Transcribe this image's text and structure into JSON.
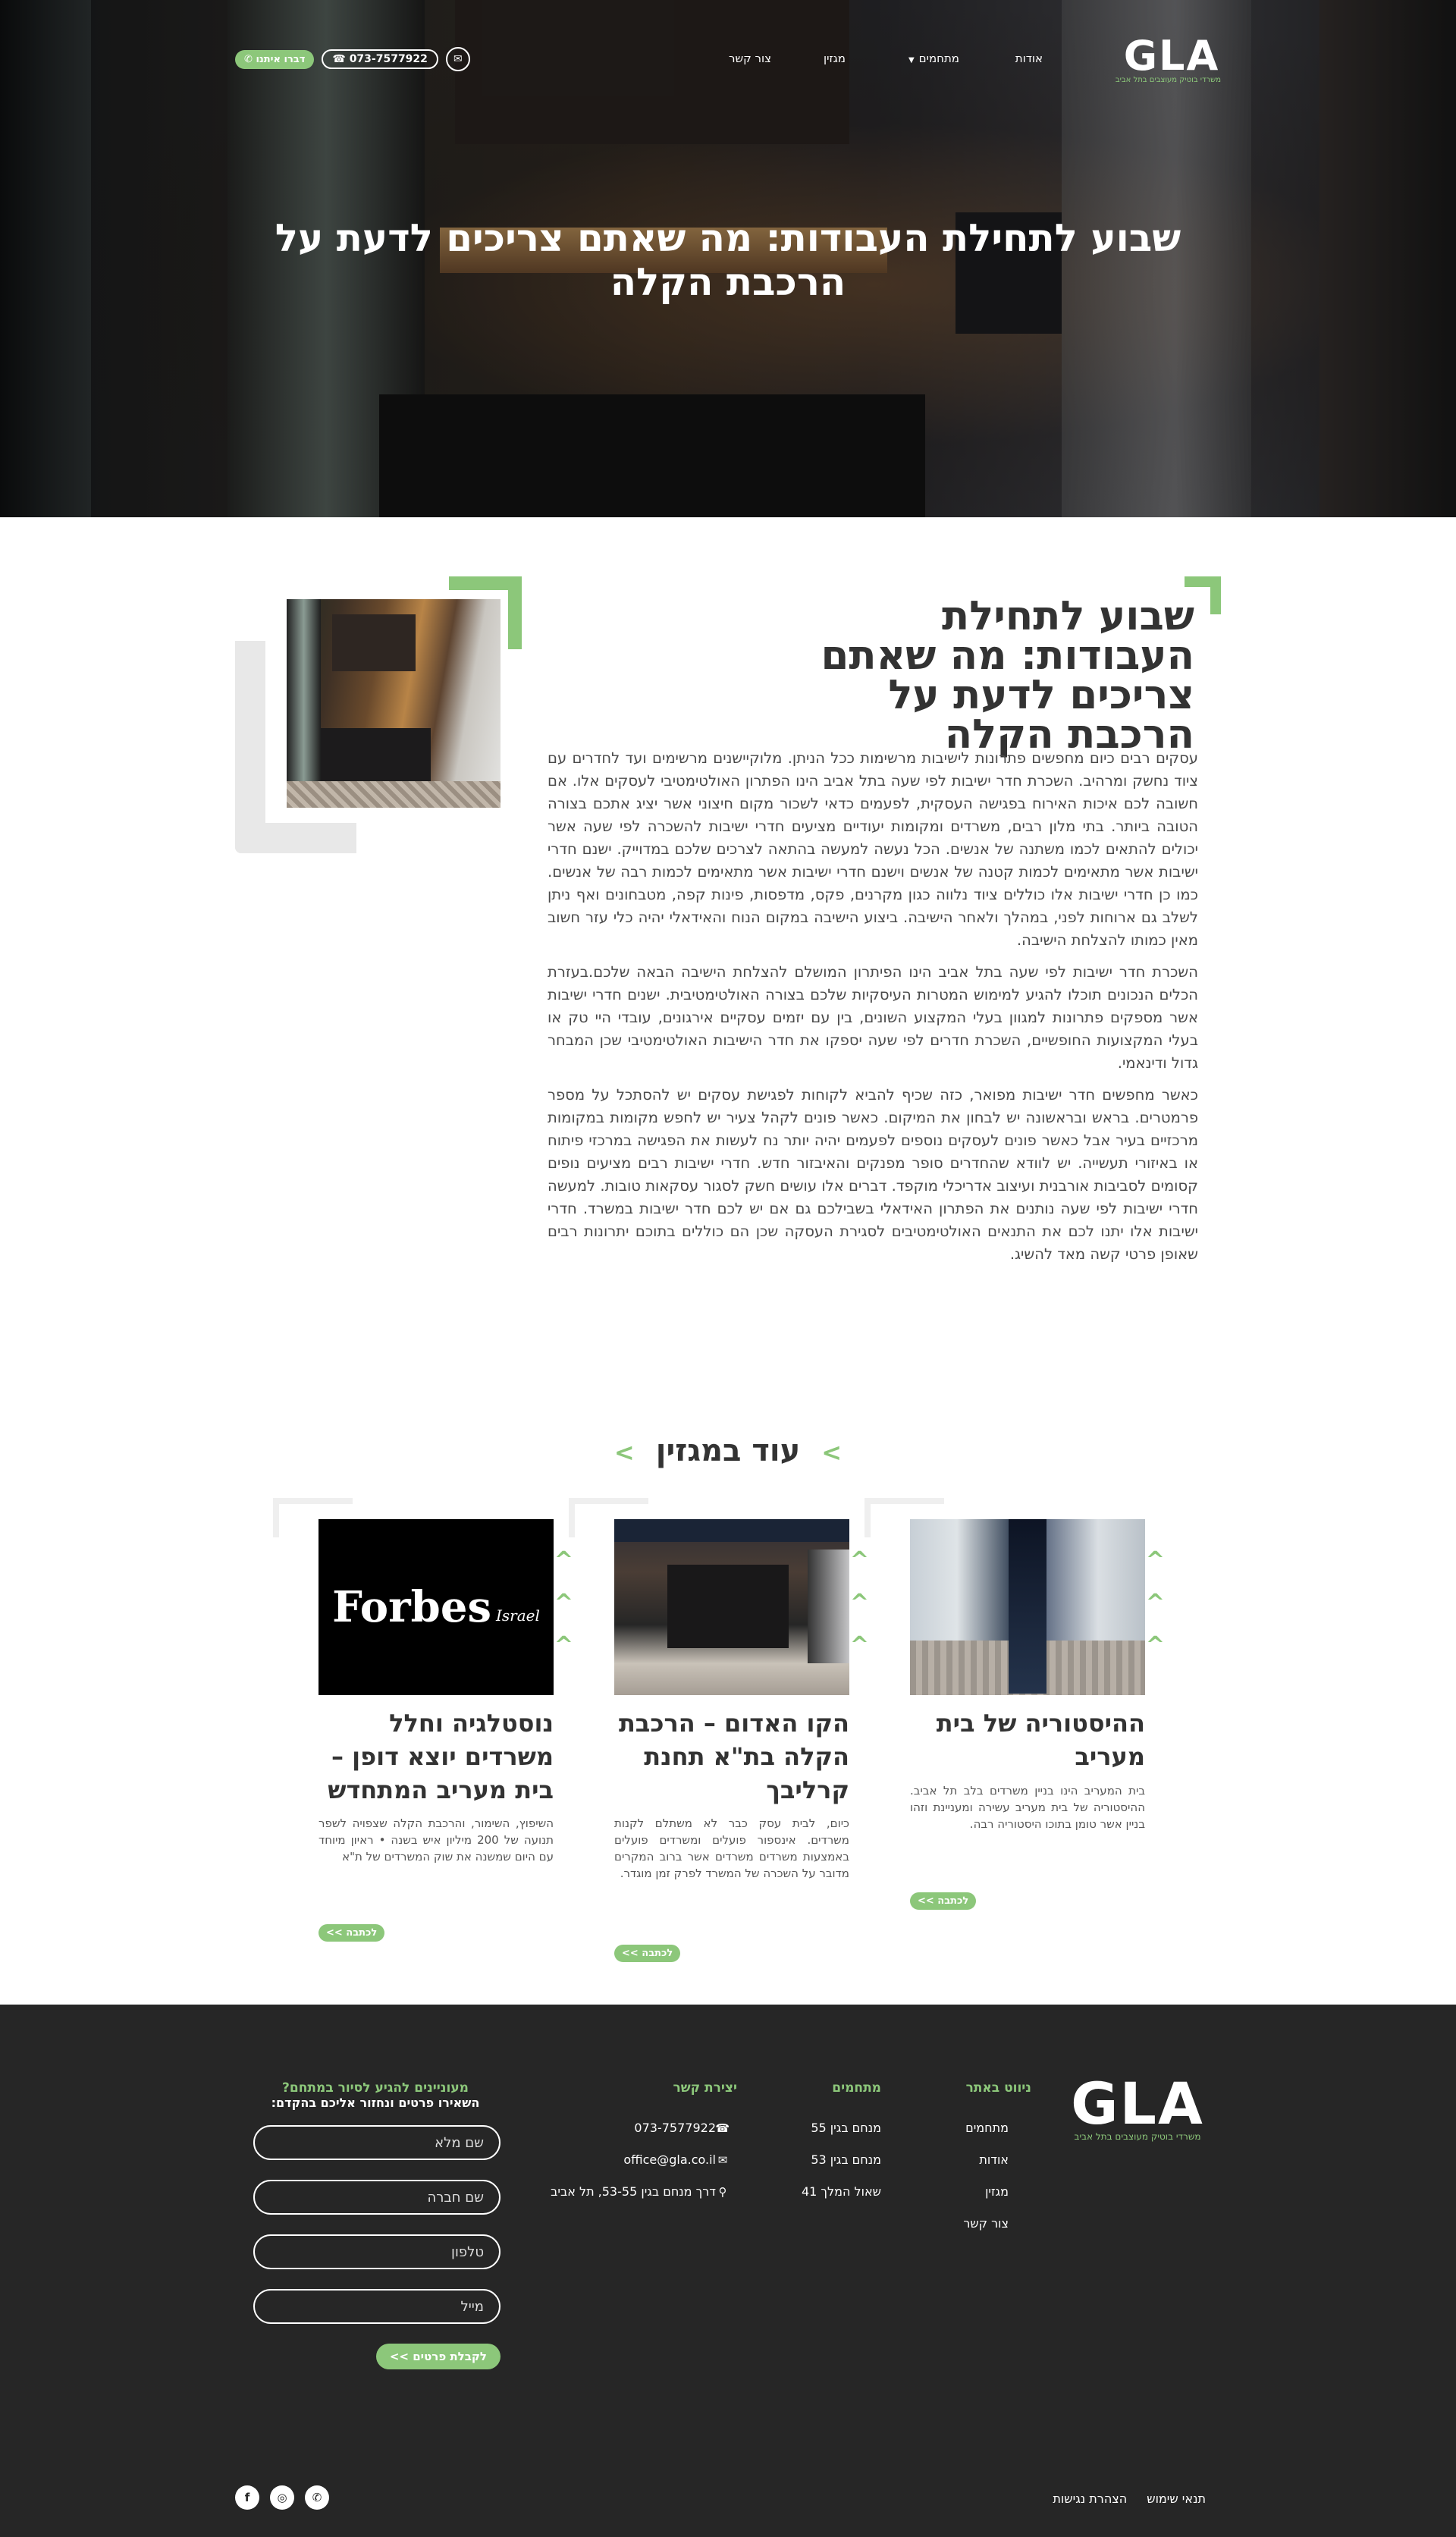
{
  "brand": {
    "logo_text": "GLA",
    "logo_sub": "משרדי בוטיק מעוצבים בתל אביב"
  },
  "nav": {
    "items": [
      "אודות",
      "מתחמים",
      "מגזין",
      "צור קשר"
    ],
    "whatsapp_label": "דברו איתנו",
    "phone_label": "073-7577922"
  },
  "hero": {
    "title": "שבוע לתחילת העבודות: מה שאתם צריכים לדעת על הרכבת הקלה"
  },
  "article": {
    "title": "שבוע לתחילת העבודות: מה שאתם צריכים לדעת על הרכבת הקלה",
    "paragraphs": [
      "עסקים רבים כיום מחפשים פתרונות לישיבות מרשימות ככל הניתן. מלוקיישנים מרשימים ועד לחדרים עם ציוד נחשק ומרהיב. השכרת חדר ישיבות לפי שעה בתל אביב הינו הפתרון האולטימטיבי לעסקים אלו. אם חשובה לכם איכות האירוח בפגישה העסקית, לפעמים כדאי לשכור מקום חיצוני אשר יציג אתכם בצורה הטובה ביותר. בתי מלון רבים, משרדים ומקומות יעודיים מציעים חדרי ישיבות להשכרה לפי שעה אשר יכולים להתאים לכמו משתנה של אנשים. הכל נעשה למעשה בהתאה לצרכים שלכם במדוייק. ישנם חדרי ישיבות אשר מתאימים לכמות קטנה של אנשים וישנם חדרי ישיבות אשר מתאימים לכמות רבה של אנשים. כמו כן חדרי ישיבות אלו כוללים ציוד נלווה כגון מקרנים, פקס, מדפסות, פינות קפה, מטבחונים ואף ניתן לשלב גם ארוחות לפני, במהלך ולאחר הישיבה. ביצוע הישיבה במקום הנוח והאידאלי יהיה כלי עזר חשוב מאין כמותו להצלחת הישיבה.",
      "השכרת חדר ישיבות לפי שעה בתל אביב הינו הפיתרון המושלם להצלחת הישיבה הבאה שלכם.בעזרת הכלים הנכונים תוכלו להגיע למימוש המטרות העיסקיות שלכם בצורה האולטימטיבית. ישנים חדרי ישיבות אשר מספקים פתרונות למגוון בעלי המקצוע השונים, בין עם יזמים עסקיים אירגונים, עובדי היי טק או בעלי המקצועות החופשיים, השכרת חדרים לפי שעה יספקו את חדר הישיבות האולטימטיבי שכן המבחר גדול ודינאמי.",
      "כאשר מחפשים חדר ישיבות מפואר, כזה שכיף להביא לקוחות לפגישת עסקים יש להסתכל על מספר פרמטרים. בראש ובראשונה יש לבחון את המיקום. כאשר פונים לקהל צעיר יש לחפש מקומות במקומות מרכזיים בעיר אבל כאשר פונים לעסקים נוספים לפעמים יהיה יותר נח לעשות את הפגישה במרכזי פיתוח או באיזורי תעשייה. יש לוודא שהחדרים סופר מפנקים והאיבזור חדש. חדרי ישיבות רבים מציעים נופים קסומים לסביבות אורבנית ועיצוב אדריכלי מוקפד. דברים אלו עושים חשק לסגור עסקאות טובות. למעשה חדרי ישיבות לפי שעה נותנים את הפתרון האידאלי בשבילכם גם אם יש לכם חדר ישיבות במשרד. חדרי ישיבות אלו יתנו לכם את התנאים האולטימטיבים לסגירת העסקה שכן הם כוללים בתוכם יתרונות רבים שאופן פרטי קשה מאד להשיג."
    ]
  },
  "more": {
    "title": "עוד במגזין",
    "read_label": "לכתבה >>",
    "cards": [
      {
        "title": "ההיסטוריה של בית מעריב",
        "excerpt": "בית המעריב הינו בניין משרדים בלב תל אביב. ההיסטוריה של בית מעריב עשירה ומעניינת וזהו בניין אשר טומן בתוכו היסטוריה רבה."
      },
      {
        "title": "הקו האדום – הרכבת הקלה בת\"א תחנת קרליבך",
        "excerpt": "כיום, לבית עסק כבר לא משתלם לקנות משרדים. אינספור פועלים ומשרדים פועלים באמצעות משרדים משרדים אשר ברוב המקרים מדובר על השכרה של המשרד לפרק זמן מוגדר."
      },
      {
        "title": "נוסטלגיה וחלל משרדים יוצא דופן – בית מעריב המתחדש",
        "excerpt": "השיפוץ, השימור, והרכבת הקלה שצפויה לשפר תנועה של 200 מיליון איש בשנה • ראיון מיוחד עם היום שמשנה את שוק המשרדים של ת\"א",
        "image_text": "Forbes",
        "image_sub": "Israel"
      }
    ]
  },
  "footer": {
    "nav_title": "ניווט באתר",
    "nav_items": [
      "מתחמים",
      "אודות",
      "מגזין",
      "צור קשר"
    ],
    "venues_title": "מתחמים",
    "venues": [
      "מנחם בגין 55",
      "מנחם בגין 53",
      "שאול המלך 41"
    ],
    "contact_title": "יצירת קשר",
    "contact": {
      "phone": "073-7577922",
      "email": "office@gla.co.il",
      "address": "דרך מנחם בגין 53-55, תל אביב"
    },
    "form_title": "מעוניינים להגיע לסיור במתחם?",
    "form_sub": "השאירו פרטים ונחזור אליכם בהקדם:",
    "form_placeholders": [
      "שם מלא",
      "שם חברה",
      "טלפון",
      "מייל"
    ],
    "form_submit": "לקבלת פרטים >>",
    "bottom_links": [
      "תנאי שימוש",
      "הצהרת נגישות"
    ]
  },
  "colors": {
    "accent": "#8cc77a",
    "footer_bg": "#262626",
    "text": "#333333"
  },
  "icons": [
    "whatsapp-icon",
    "phone-icon",
    "mail-icon",
    "map-pin-icon",
    "facebook-icon",
    "instagram-icon"
  ]
}
